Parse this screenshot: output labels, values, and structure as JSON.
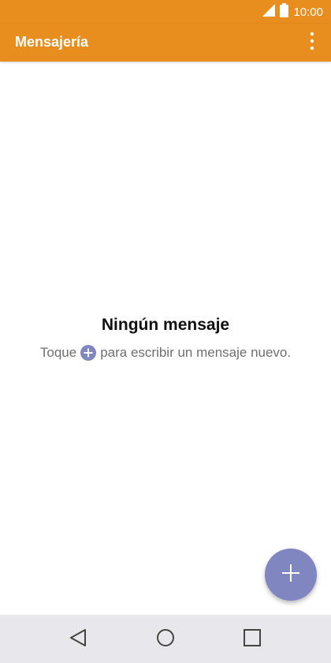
{
  "status_bar": {
    "time": "10:00",
    "icons": [
      "signal-icon",
      "battery-icon"
    ]
  },
  "app_bar": {
    "title": "Mensajería",
    "menu_icon": "overflow-menu-icon"
  },
  "empty_state": {
    "title": "Ningún mensaje",
    "hint_before": "Toque",
    "hint_icon": "plus-circle-icon",
    "hint_after": "para escribir un mensaje nuevo."
  },
  "fab": {
    "icon": "plus-icon"
  },
  "nav_bar": {
    "buttons": [
      "back-icon",
      "home-icon",
      "recents-icon"
    ]
  },
  "colors": {
    "app_bar": "#e88e1e",
    "fab": "#7f86c0",
    "nav_bar": "#e8e8ec",
    "hint_text": "#6f6f6f"
  }
}
